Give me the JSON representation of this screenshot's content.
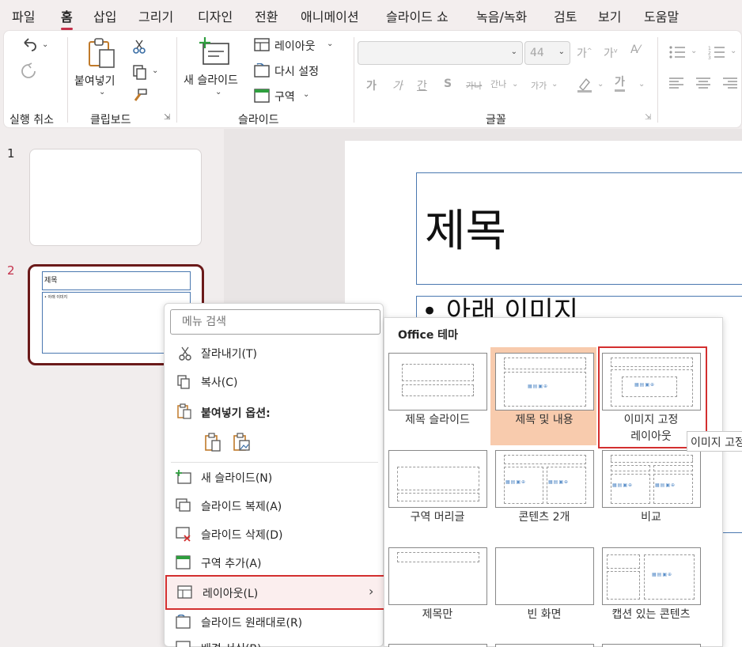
{
  "menu_tabs": [
    "파일",
    "홈",
    "삽입",
    "그리기",
    "디자인",
    "전환",
    "애니메이션",
    "슬라이드 쇼",
    "녹음/녹화",
    "검토",
    "보기",
    "도움말"
  ],
  "active_tab": "홈",
  "ribbon": {
    "undo_group": "실행 취소",
    "clipboard": {
      "paste": "붙여넣기",
      "group": "클립보드"
    },
    "slides": {
      "new_slide": "새 슬라이드",
      "layout": "레이아웃",
      "reset": "다시 설정",
      "section": "구역",
      "group": "슬라이드"
    },
    "font": {
      "size": "44",
      "group": "글꼴",
      "buttons": [
        "가",
        "가",
        "간",
        "S",
        "가나",
        "간나",
        "가가"
      ]
    }
  },
  "thumbnails": [
    {
      "num": "1"
    },
    {
      "num": "2",
      "title": "제목",
      "body": "• 아래 이미지"
    }
  ],
  "slide": {
    "title": "제목",
    "body": "• 아래 이미지"
  },
  "context_menu": {
    "search_placeholder": "메뉴 검색",
    "cut": "잘라내기(T)",
    "copy": "복사(C)",
    "paste_options": "붙여넣기 옵션:",
    "new_slide": "새 슬라이드(N)",
    "duplicate": "슬라이드 복제(A)",
    "delete": "슬라이드 삭제(D)",
    "add_section": "구역 추가(A)",
    "layout": "레이아웃(L)",
    "reset": "슬라이드 원래대로(R)",
    "format_bg": "배경 서식(B)..."
  },
  "layout_gallery": {
    "header": "Office 테마",
    "items": [
      "제목 슬라이드",
      "제목 및 내용",
      "이미지 고정 레이아웃",
      "구역 머리글",
      "콘텐츠 2개",
      "비교",
      "제목만",
      "빈 화면",
      "캡션 있는 콘텐츠"
    ],
    "item3_line1": "이미지 고정",
    "item3_line2": "레이아웃"
  },
  "tooltip": "이미지 고정 레이아웃",
  "colors": {
    "accent": "#c4314b",
    "highlight": "#f8cbad",
    "selection_border": "#d32f2f",
    "thumb_border": "#6b1a1a"
  }
}
